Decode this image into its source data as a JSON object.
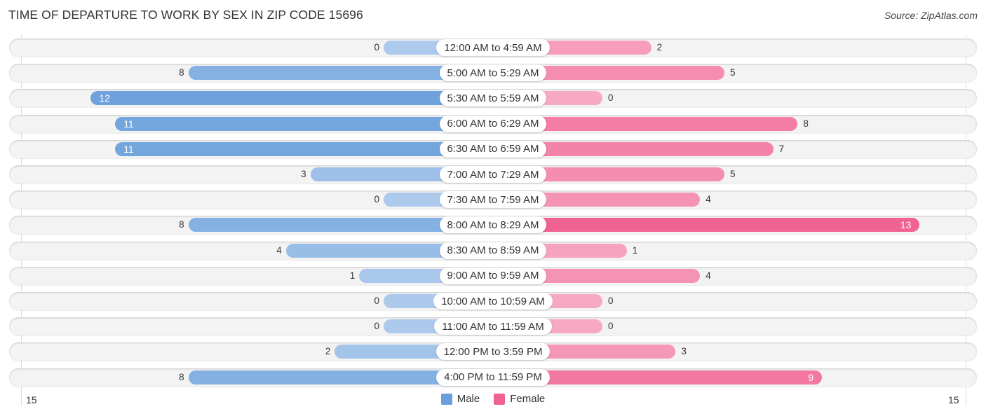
{
  "chart_data": {
    "type": "bar",
    "orientation": "horizontal-diverging",
    "title": "TIME OF DEPARTURE TO WORK BY SEX IN ZIP CODE 15696",
    "source": "Source: ZipAtlas.com",
    "categories": [
      "12:00 AM to 4:59 AM",
      "5:00 AM to 5:29 AM",
      "5:30 AM to 5:59 AM",
      "6:00 AM to 6:29 AM",
      "6:30 AM to 6:59 AM",
      "7:00 AM to 7:29 AM",
      "7:30 AM to 7:59 AM",
      "8:00 AM to 8:29 AM",
      "8:30 AM to 8:59 AM",
      "9:00 AM to 9:59 AM",
      "10:00 AM to 10:59 AM",
      "11:00 AM to 11:59 AM",
      "12:00 PM to 3:59 PM",
      "4:00 PM to 11:59 PM"
    ],
    "series": [
      {
        "name": "Male",
        "color": "#6a9fdc",
        "values": [
          0,
          8,
          12,
          11,
          11,
          3,
          0,
          8,
          4,
          1,
          0,
          0,
          2,
          8
        ]
      },
      {
        "name": "Female",
        "color": "#f06292",
        "values": [
          2,
          5,
          0,
          8,
          7,
          5,
          4,
          13,
          1,
          4,
          0,
          0,
          3,
          9
        ]
      }
    ],
    "axis": {
      "left_label": "15",
      "right_label": "15",
      "max": 15
    },
    "legend": {
      "position": "bottom-center",
      "items": [
        "Male",
        "Female"
      ]
    },
    "grid": false
  }
}
